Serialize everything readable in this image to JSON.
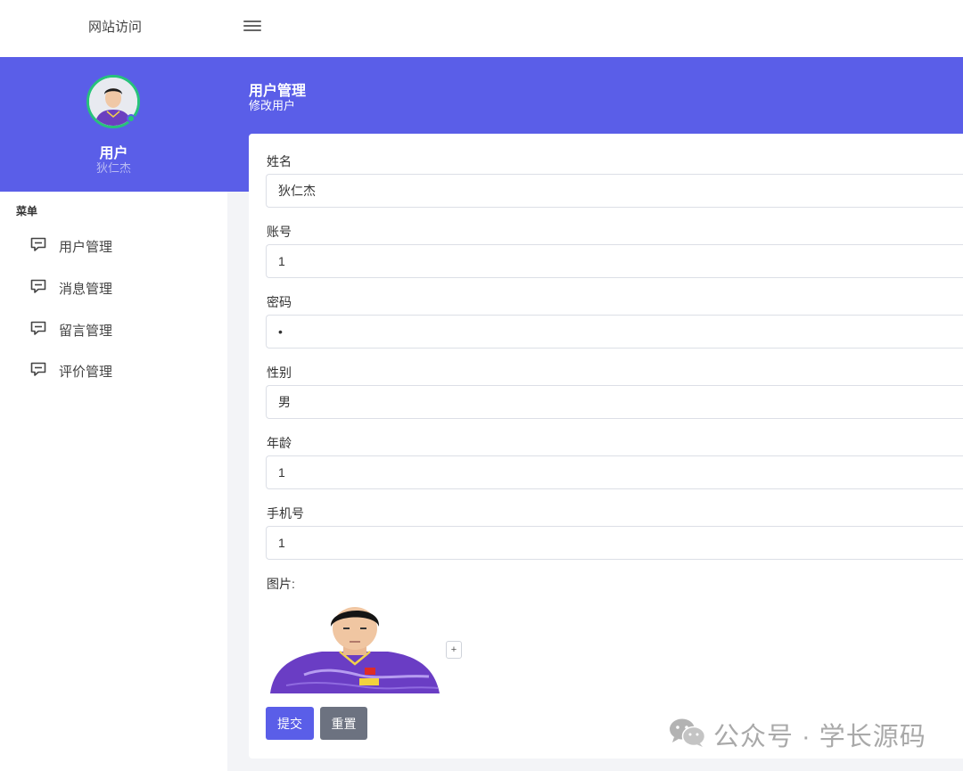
{
  "topbar": {
    "site_link": "网站访问",
    "menu_icon": "hamburger-icon"
  },
  "profile": {
    "avatar_icon": "user-avatar",
    "name": "用户",
    "subtitle": "狄仁杰",
    "status_color": "#27c27b"
  },
  "sidebar": {
    "menu_title": "菜单",
    "items": [
      {
        "label": "用户管理",
        "icon": "message-square-icon"
      },
      {
        "label": "消息管理",
        "icon": "message-square-icon"
      },
      {
        "label": "留言管理",
        "icon": "message-square-icon"
      },
      {
        "label": "评价管理",
        "icon": "message-square-icon"
      }
    ]
  },
  "header": {
    "title": "用户管理",
    "subtitle": "修改用户"
  },
  "form": {
    "fields": [
      {
        "label": "姓名",
        "value": "狄仁杰"
      },
      {
        "label": "账号",
        "value": "1"
      },
      {
        "label": "密码",
        "value": "1"
      },
      {
        "label": "性别",
        "value": "男"
      },
      {
        "label": "年龄",
        "value": "1"
      },
      {
        "label": "手机号",
        "value": "1"
      }
    ],
    "image_label": "图片:",
    "add_image_label": "+",
    "submit_label": "提交",
    "reset_label": "重置"
  },
  "watermark": {
    "text": "公众号 · 学长源码",
    "icon": "wechat-icon"
  },
  "colors": {
    "primary": "#5a5ee8",
    "reset": "#6c7280",
    "background": "#f3f4f7"
  }
}
